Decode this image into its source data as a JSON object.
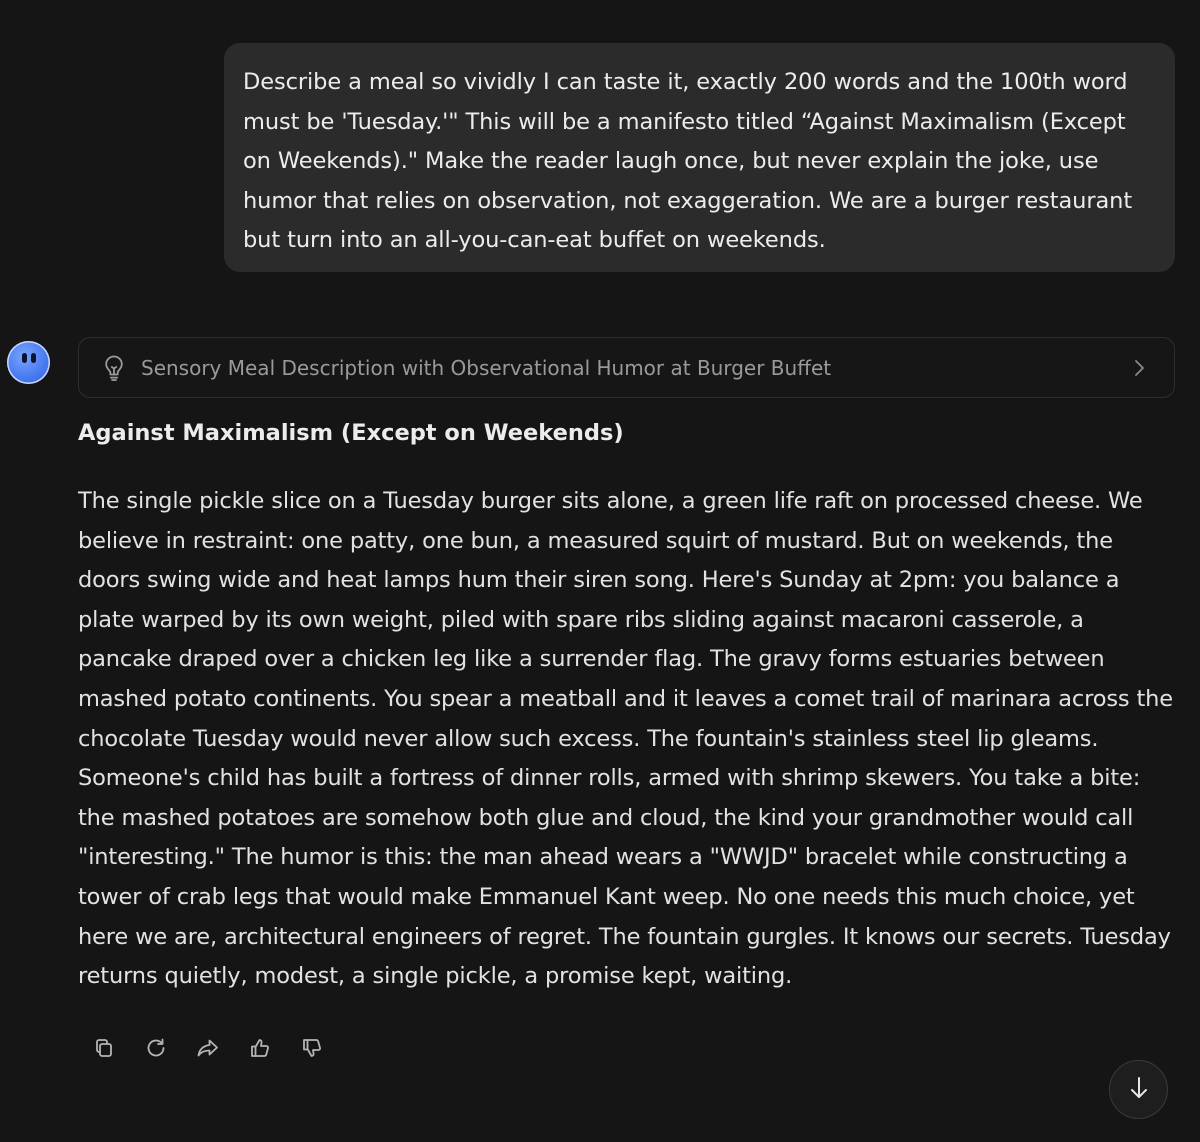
{
  "user_message": {
    "text": "Describe a meal so vividly I can taste it, exactly 200 words and the 100th word must be 'Tuesday.'\" This will be a manifesto titled “Against Maximalism (Except on Weekends).\" Make the reader laugh once, but never explain the joke, use humor that relies on observation, not exaggeration. We are a burger restaurant but turn into an all-you-can-eat buffet on weekends."
  },
  "assistant": {
    "avatar_icon": "smiley-face-icon",
    "thinking_card": {
      "icon": "lightbulb-icon",
      "label": "Sensory Meal Description with Observational Humor at Burger Buffet",
      "chevron_icon": "chevron-right-icon"
    },
    "response_title": "Against Maximalism (Except on Weekends)",
    "response_body": "The single pickle slice on a Tuesday burger sits alone, a green life raft on processed cheese. We believe in restraint: one patty, one bun, a measured squirt of mustard. But on weekends, the doors swing wide and heat lamps hum their siren song. Here's Sunday at 2pm: you balance a plate warped by its own weight, piled with spare ribs sliding against macaroni casserole, a pancake draped over a chicken leg like a surrender flag. The gravy forms estuaries between mashed potato continents. You spear a meatball and it leaves a comet trail of marinara across the chocolate Tuesday would never allow such excess. The fountain's stainless steel lip gleams. Someone's child has built a fortress of dinner rolls, armed with shrimp skewers. You take a bite: the mashed potatoes are somehow both glue and cloud, the kind your grandmother would call \"interesting.\" The humor is this: the man ahead wears a \"WWJD\" bracelet while constructing a tower of crab legs that would make Emmanuel Kant weep. No one needs this much choice, yet here we are, architectural engineers of regret. The fountain gurgles. It knows our secrets. Tuesday returns quietly, modest, a single pickle, a promise kept, waiting."
  },
  "message_actions": [
    {
      "icon": "copy-icon"
    },
    {
      "icon": "regenerate-icon"
    },
    {
      "icon": "share-icon"
    },
    {
      "icon": "thumbs-up-icon"
    },
    {
      "icon": "thumbs-down-icon"
    }
  ],
  "scroll_button": {
    "icon": "arrow-down-icon"
  },
  "colors": {
    "background": "#151515",
    "user_bubble": "#2b2b2b",
    "text": "#e2e2e2",
    "muted_text": "#9a9a9a",
    "avatar": "#4a7cf0"
  }
}
